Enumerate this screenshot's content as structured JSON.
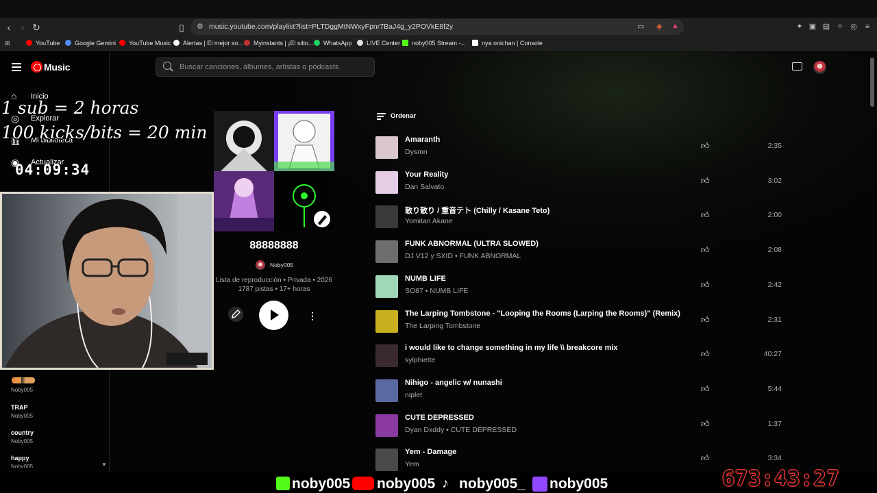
{
  "browser": {
    "url": "music.youtube.com/playlist?list=PLTDggMtNWxyFpnr7BaJ4g_y2POVkE8f2y",
    "bookmarks": [
      {
        "label": "YouTube",
        "color": "#ff0000"
      },
      {
        "label": "Google Gemini",
        "color": "#4f8ef7"
      },
      {
        "label": "YouTube Music",
        "color": "#ff0000"
      },
      {
        "label": "Alertas | El mejor so...",
        "color": "#ffffff"
      },
      {
        "label": "Myinstants | ¡El sitio...",
        "color": "#c03030"
      },
      {
        "label": "WhatsApp",
        "color": "#25d366"
      },
      {
        "label": "LIVE Center",
        "color": "#e0e0e0"
      },
      {
        "label": "noby005 Stream -...",
        "color": "#53fc18"
      },
      {
        "label": "nya onichan | Console",
        "color": "#ffffff"
      }
    ]
  },
  "app": {
    "logo_text": "Music",
    "search_placeholder": "Buscar canciones, álbumes, artistas o pódcasts"
  },
  "sidebar": {
    "nav": [
      {
        "label": "Inicio",
        "icon": "home-icon"
      },
      {
        "label": "Explorar",
        "icon": "explore-icon"
      },
      {
        "label": "Mi biblioteca",
        "icon": "library-icon"
      },
      {
        "label": "Actualizar",
        "icon": "upgrade-icon"
      }
    ],
    "playlists": [
      {
        "title": "",
        "owner": "Noby005"
      },
      {
        "title": "TRAP",
        "owner": "Noby005"
      },
      {
        "title": "country",
        "owner": "Noby005"
      },
      {
        "title": "happy",
        "owner": "Noby005"
      }
    ]
  },
  "overlay": {
    "line1": "1 sub = 2 horas",
    "line2": "100 kicks/bits = 20 min",
    "timer_small": "04:09:34",
    "timer_big": "673:43:27",
    "socials": [
      {
        "platform": "kick-icon",
        "handle": "noby005",
        "color": "#53fc18"
      },
      {
        "platform": "youtube-icon",
        "handle": "noby005",
        "color": "#ff0000"
      },
      {
        "platform": "tiktok-icon",
        "handle": "noby005_",
        "color": "#ffffff"
      },
      {
        "platform": "twitch-icon",
        "handle": "noby005",
        "color": "#9146ff"
      }
    ]
  },
  "playlist": {
    "name": "88888888",
    "owner": "Noby005",
    "meta_line1": "Lista de reproducción • Privada • 2026",
    "meta_line2": "1787 pistas • 17+ horas",
    "sort_label": "Ordenar"
  },
  "tracks": [
    {
      "title": "Amaranth",
      "artist": "Dysmn",
      "duration": "2:35",
      "thumb": "#d9c6cf"
    },
    {
      "title": "Your Reality",
      "artist": "Dan Salvato",
      "duration": "3:02",
      "thumb": "#e6cde6"
    },
    {
      "title": "散り散り / 重音テト (Chilly / Kasane Teto)",
      "artist": "Yomitan Akane",
      "duration": "2:00",
      "thumb": "#3a3a3a"
    },
    {
      "title": "FUNK ABNORMAL (ULTRA SLOWED)",
      "artist": "DJ V12 y SXID • FUNK ABNORMAL",
      "duration": "2:08",
      "thumb": "#6e6e6e"
    },
    {
      "title": "NUMB LIFE",
      "artist": "SO87 • NUMB LIFE",
      "duration": "2:42",
      "thumb": "#9fd8b8"
    },
    {
      "title": "The Larping Tombstone - \"Looping the Rooms (Larping the Rooms)\" (Remix)",
      "artist": "The Larping Tombstone",
      "duration": "2:31",
      "thumb": "#c8b020"
    },
    {
      "title": "i would like to change something in my life \\\\ breakcore mix",
      "artist": "sylphiette",
      "duration": "40:27",
      "thumb": "#3a2a30"
    },
    {
      "title": "Nihigo - angelic w/ nunashi",
      "artist": "niplet",
      "duration": "5:44",
      "thumb": "#5a6aa0"
    },
    {
      "title": "CUTE DEPRESSED",
      "artist": "Dyan Dxddy • CUTE DEPRESSED",
      "duration": "1:37",
      "thumb": "#8a3aa0"
    },
    {
      "title": "Yem - Damage",
      "artist": "Yem",
      "duration": "3:34",
      "thumb": "#4a4a4a"
    }
  ]
}
